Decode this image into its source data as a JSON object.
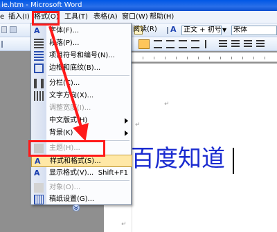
{
  "window": {
    "title": "ie.htm - Microsoft Word"
  },
  "menubar": {
    "items": [
      {
        "label": "插入(I)"
      },
      {
        "label": "格式(O)"
      },
      {
        "label": "工具(T)"
      },
      {
        "label": "表格(A)"
      },
      {
        "label": "窗口(W)"
      },
      {
        "label": "帮助(H)"
      }
    ]
  },
  "toolbar": {
    "reading_label": "阅读(R)",
    "style_value": "正文 + 初号",
    "font_value": "宋体"
  },
  "format_menu": {
    "items": [
      {
        "label": "字体(F)...",
        "icon": "font-A-icon"
      },
      {
        "label": "段落(P)...",
        "icon": "paragraph-icon"
      },
      {
        "label": "项目符号和编号(N)...",
        "icon": "list-icon"
      },
      {
        "label": "边框和底纹(B)...",
        "icon": "border-icon"
      },
      {
        "label": "分栏(C)...",
        "icon": "columns-icon"
      },
      {
        "label": "文字方向(X)...",
        "icon": "text-direction-icon"
      },
      {
        "label": "调整宽度(I)...",
        "icon": "",
        "disabled": true
      },
      {
        "label": "中文版式(H)",
        "icon": "",
        "submenu": true
      },
      {
        "label": "背景(K)",
        "icon": "",
        "submenu": true
      },
      {
        "label": "主题(H)...",
        "icon": "theme-icon",
        "disabled": true
      },
      {
        "label": "样式和格式(S)...",
        "icon": "styles-icon",
        "highlighted": true
      },
      {
        "label": "显示格式(V)...",
        "icon": "reveal-format-icon",
        "shortcut": "Shift+F1"
      },
      {
        "label": "对象(O)...",
        "icon": "object-icon",
        "disabled": true
      },
      {
        "label": "稿纸设置(G)...",
        "icon": "grid-paper-icon"
      }
    ],
    "expand_icon": "chevron-double-down-icon"
  },
  "document": {
    "text": "百度知道",
    "paragraph_mark": "↵"
  },
  "colors": {
    "annotation_red": "#ff1a1a",
    "document_text": "#1a2bd0"
  }
}
